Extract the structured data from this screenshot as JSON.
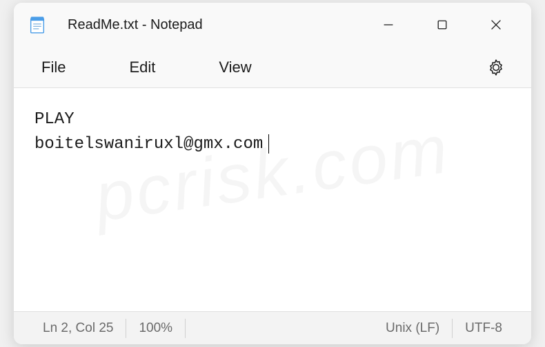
{
  "titlebar": {
    "title": "ReadMe.txt - Notepad"
  },
  "menubar": {
    "file": "File",
    "edit": "Edit",
    "view": "View"
  },
  "editor": {
    "line1": "PLAY",
    "line2": "boitelswaniruxl@gmx.com"
  },
  "statusbar": {
    "position": "Ln 2, Col 25",
    "zoom": "100%",
    "lineending": "Unix (LF)",
    "encoding": "UTF-8"
  },
  "watermark": "pcrisk.com"
}
